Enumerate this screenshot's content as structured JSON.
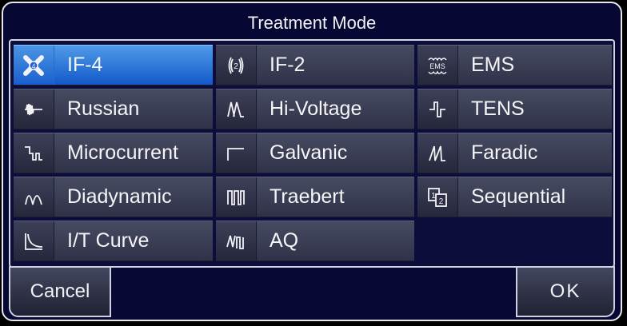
{
  "dialog": {
    "title": "Treatment Mode",
    "cancel_label": "Cancel",
    "ok_label": "OK"
  },
  "modes": [
    {
      "label": "IF-4",
      "icon": "if4-icon",
      "selected": true
    },
    {
      "label": "IF-2",
      "icon": "if2-icon",
      "selected": false
    },
    {
      "label": "EMS",
      "icon": "ems-icon",
      "icon_text": "EMS",
      "selected": false
    },
    {
      "label": "Russian",
      "icon": "russian-wave-icon",
      "selected": false
    },
    {
      "label": "Hi-Voltage",
      "icon": "hi-voltage-wave-icon",
      "selected": false
    },
    {
      "label": "TENS",
      "icon": "tens-wave-icon",
      "selected": false
    },
    {
      "label": "Microcurrent",
      "icon": "microcurrent-wave-icon",
      "selected": false
    },
    {
      "label": "Galvanic",
      "icon": "galvanic-wave-icon",
      "selected": false
    },
    {
      "label": "Faradic",
      "icon": "faradic-wave-icon",
      "selected": false
    },
    {
      "label": "Diadynamic",
      "icon": "diadynamic-wave-icon",
      "selected": false
    },
    {
      "label": "Traebert",
      "icon": "traebert-wave-icon",
      "selected": false
    },
    {
      "label": "Sequential",
      "icon": "sequential-icon",
      "selected": false
    },
    {
      "label": "I/T Curve",
      "icon": "it-curve-icon",
      "selected": false
    },
    {
      "label": "AQ",
      "icon": "aq-wave-icon",
      "selected": false
    }
  ],
  "colors": {
    "selected": "#1a63d3",
    "background": "#060733",
    "button": "#3a3d55"
  }
}
